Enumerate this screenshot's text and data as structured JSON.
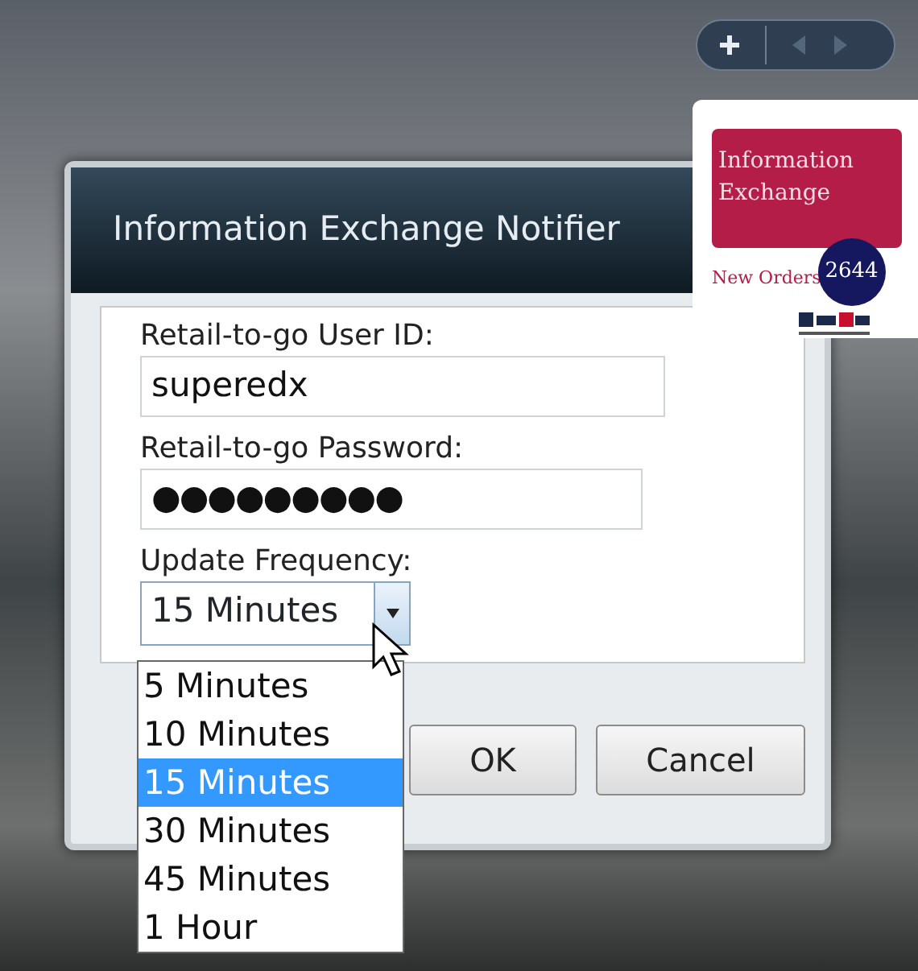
{
  "gadget": {
    "title": "Information Exchange",
    "counter_label": "New Orders",
    "count": "2644"
  },
  "dialog": {
    "title": "Information Exchange Notifier",
    "fields": [
      {
        "kind": "text",
        "label": "Retail-to-go User ID:",
        "value": "superedx"
      },
      {
        "kind": "password",
        "label": "Retail-to-go Password:",
        "value": "●●●●●●●●●"
      }
    ],
    "frequency": {
      "label": "Update Frequency:",
      "value": "15 Minutes",
      "expanded": true,
      "options": [
        {
          "label": "5 Minutes",
          "selected": false
        },
        {
          "label": "10 Minutes",
          "selected": false
        },
        {
          "label": "15 Minutes",
          "selected": true
        },
        {
          "label": "30 Minutes",
          "selected": false
        },
        {
          "label": "45 Minutes",
          "selected": false
        },
        {
          "label": "1 Hour",
          "selected": false
        }
      ]
    },
    "buttons": [
      "OK",
      "Cancel"
    ]
  }
}
